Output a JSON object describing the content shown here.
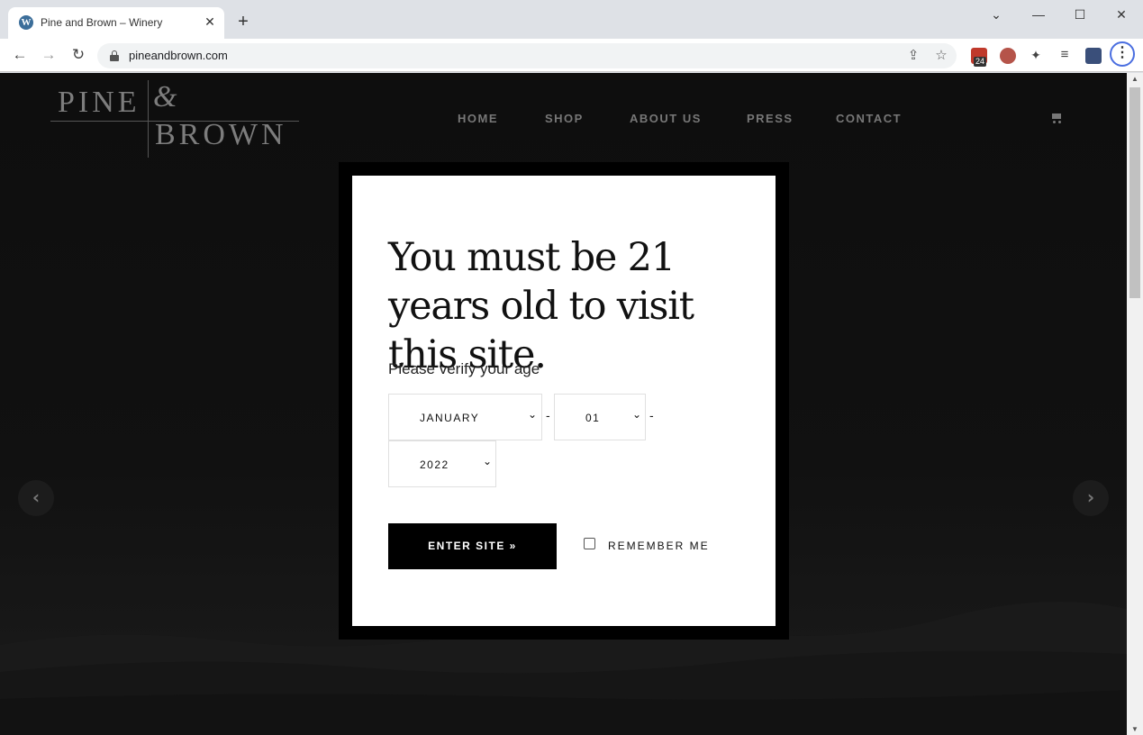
{
  "browser": {
    "tab_title": "Pine and Brown – Winery",
    "tab_close": "✕",
    "new_tab": "+",
    "url": "pineandbrown.com",
    "back": "←",
    "forward": "→",
    "reload": "↻",
    "minimize": "—",
    "maximize": "☐",
    "close": "✕",
    "collapse": "⌄",
    "share_icon": "⇪",
    "star_icon": "☆",
    "puzzle_icon": "✦",
    "playlist_icon": "≡",
    "menu_icon": "⋮",
    "ext_badge": "24"
  },
  "site": {
    "logo": {
      "pine": "PINE",
      "amp": "&",
      "brown": "BROWN"
    },
    "nav": [
      "HOME",
      "SHOP",
      "ABOUT US",
      "PRESS",
      "CONTACT"
    ],
    "prev_arrow": "‹",
    "next_arrow": "›"
  },
  "age_gate": {
    "heading": "You must be 21 years old to visit this site.",
    "verify_label": "Please verify your age",
    "month": "JANUARY",
    "day": "01",
    "year": "2022",
    "separator": "-",
    "enter_button": "ENTER SITE »",
    "remember_label": "REMEMBER ME",
    "remember_checked": false
  },
  "colors": {
    "modal_frame": "#000000",
    "modal_bg": "#ffffff",
    "button_bg": "#000000",
    "page_bg": "#111111"
  }
}
